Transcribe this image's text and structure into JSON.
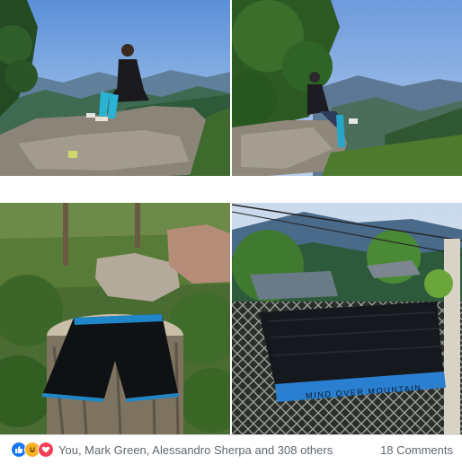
{
  "photos": [
    {
      "alt": ""
    },
    {
      "alt": ""
    },
    {
      "alt": ""
    },
    {
      "alt": ""
    }
  ],
  "shorts_print": "MIND OVER MOUNTAIN",
  "reactions": {
    "icons": [
      "like-icon",
      "haha-icon",
      "love-icon"
    ],
    "summary": "You, Mark Green, Alessandro Sherpa and 308 others",
    "comments": "18 Comments"
  },
  "colors": {
    "like": "#1877f2",
    "haha": "#f7b125",
    "love": "#f33e58",
    "meta_text": "#606770"
  }
}
